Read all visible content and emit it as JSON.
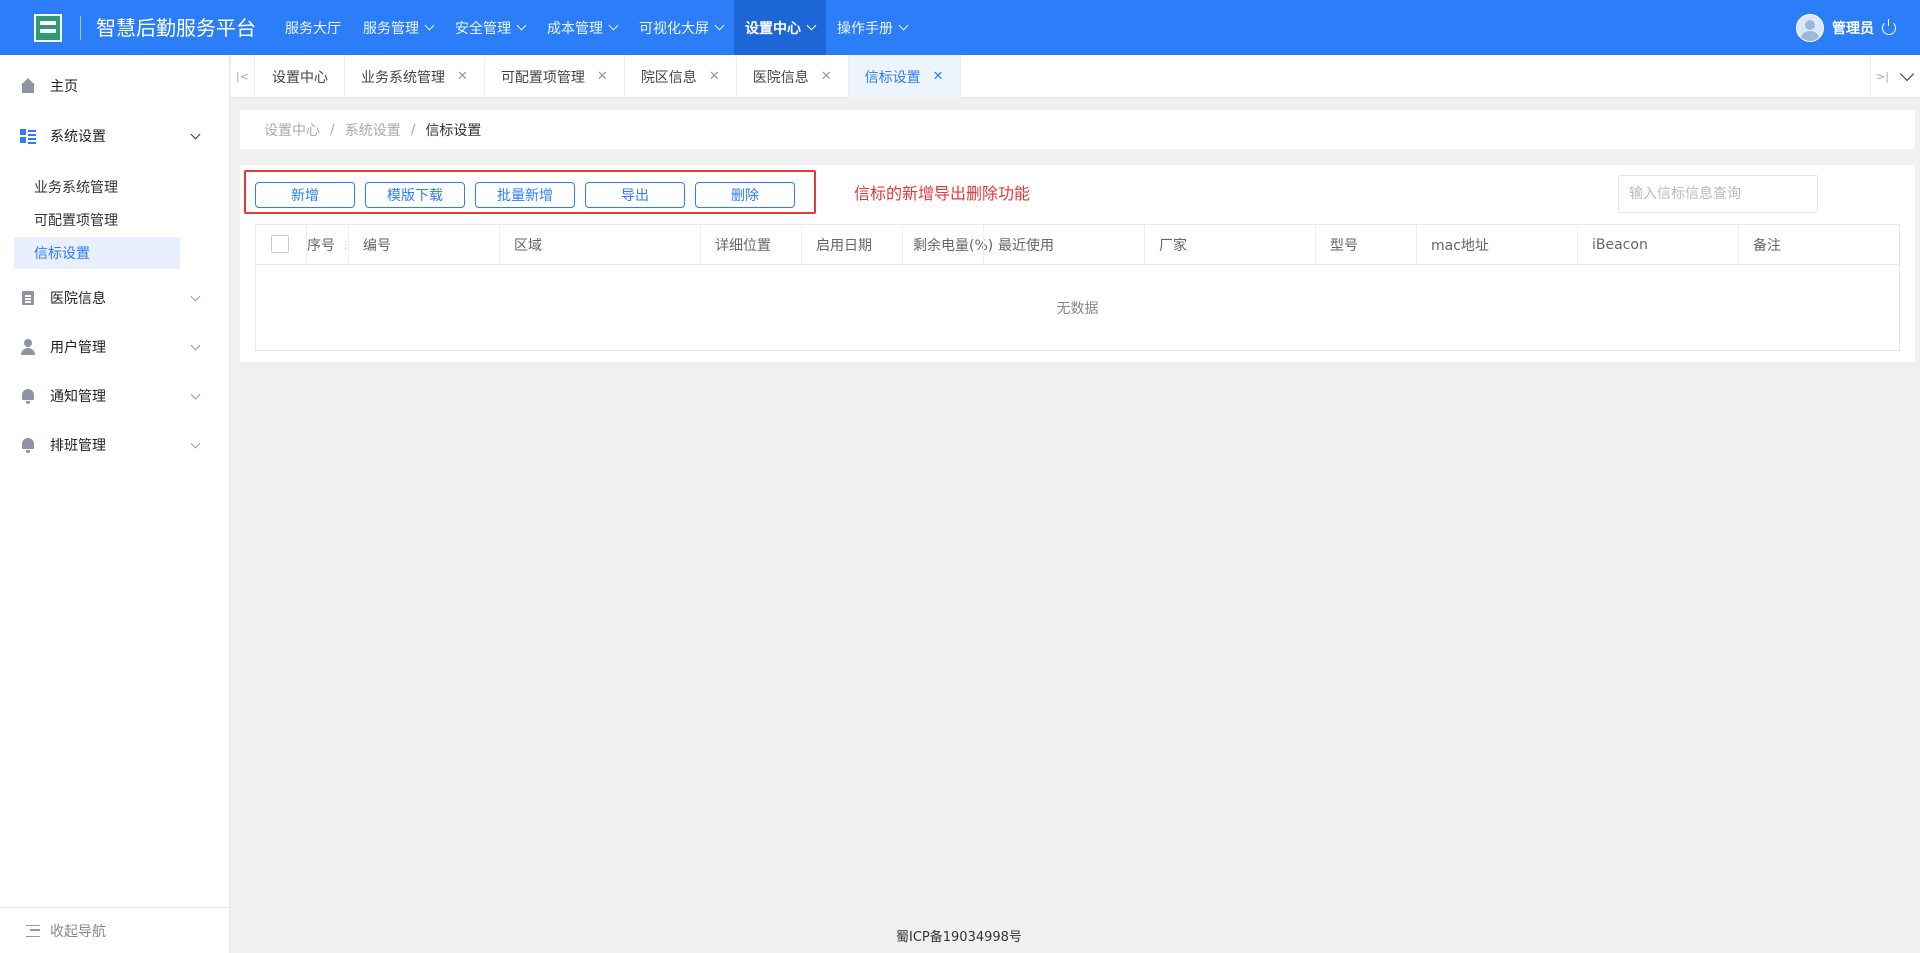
{
  "app": {
    "title": "智慧后勤服务平台"
  },
  "topnav": [
    {
      "label": "服务大厅",
      "has_dropdown": false
    },
    {
      "label": "服务管理",
      "has_dropdown": true
    },
    {
      "label": "安全管理",
      "has_dropdown": true
    },
    {
      "label": "成本管理",
      "has_dropdown": true
    },
    {
      "label": "可视化大屏",
      "has_dropdown": true
    },
    {
      "label": "设置中心",
      "has_dropdown": true,
      "active": true
    },
    {
      "label": "操作手册",
      "has_dropdown": true
    }
  ],
  "user": {
    "name": "管理员"
  },
  "sidebar": {
    "items": [
      {
        "label": "主页",
        "icon": "home-icon"
      },
      {
        "label": "系统设置",
        "icon": "grid-icon",
        "expanded": true
      },
      {
        "label": "医院信息",
        "icon": "document-icon"
      },
      {
        "label": "用户管理",
        "icon": "user-icon"
      },
      {
        "label": "通知管理",
        "icon": "bell-icon"
      },
      {
        "label": "排班管理",
        "icon": "bell-icon"
      }
    ],
    "sub_items": [
      {
        "label": "业务系统管理"
      },
      {
        "label": "可配置项管理"
      },
      {
        "label": "信标设置",
        "active": true
      }
    ],
    "collapse_label": "收起导航"
  },
  "tabs": [
    {
      "label": "设置中心",
      "closable": false
    },
    {
      "label": "业务系统管理",
      "closable": true
    },
    {
      "label": "可配置项管理",
      "closable": true
    },
    {
      "label": "院区信息",
      "closable": true
    },
    {
      "label": "医院信息",
      "closable": true
    },
    {
      "label": "信标设置",
      "closable": true,
      "active": true
    }
  ],
  "breadcrumb": [
    "设置中心",
    "系统设置",
    "信标设置"
  ],
  "toolbar": {
    "buttons": [
      "新增",
      "模版下载",
      "批量新增",
      "导出",
      "删除"
    ],
    "annotation": "信标的新增导出删除功能",
    "search_placeholder": "输入信标信息查询"
  },
  "table": {
    "columns": [
      "序号",
      "编号",
      "区域",
      "详细位置",
      "启用日期",
      "剩余电量(%)",
      "最近使用",
      "厂家",
      "型号",
      "mac地址",
      "iBeacon",
      "备注"
    ],
    "empty_text": "无数据"
  },
  "footer": {
    "icp": "蜀ICP备19034998号"
  },
  "colors": {
    "primary": "#2b7ef7",
    "annotation_red": "#e53935",
    "active_nav_bg": "#1c66d8"
  }
}
